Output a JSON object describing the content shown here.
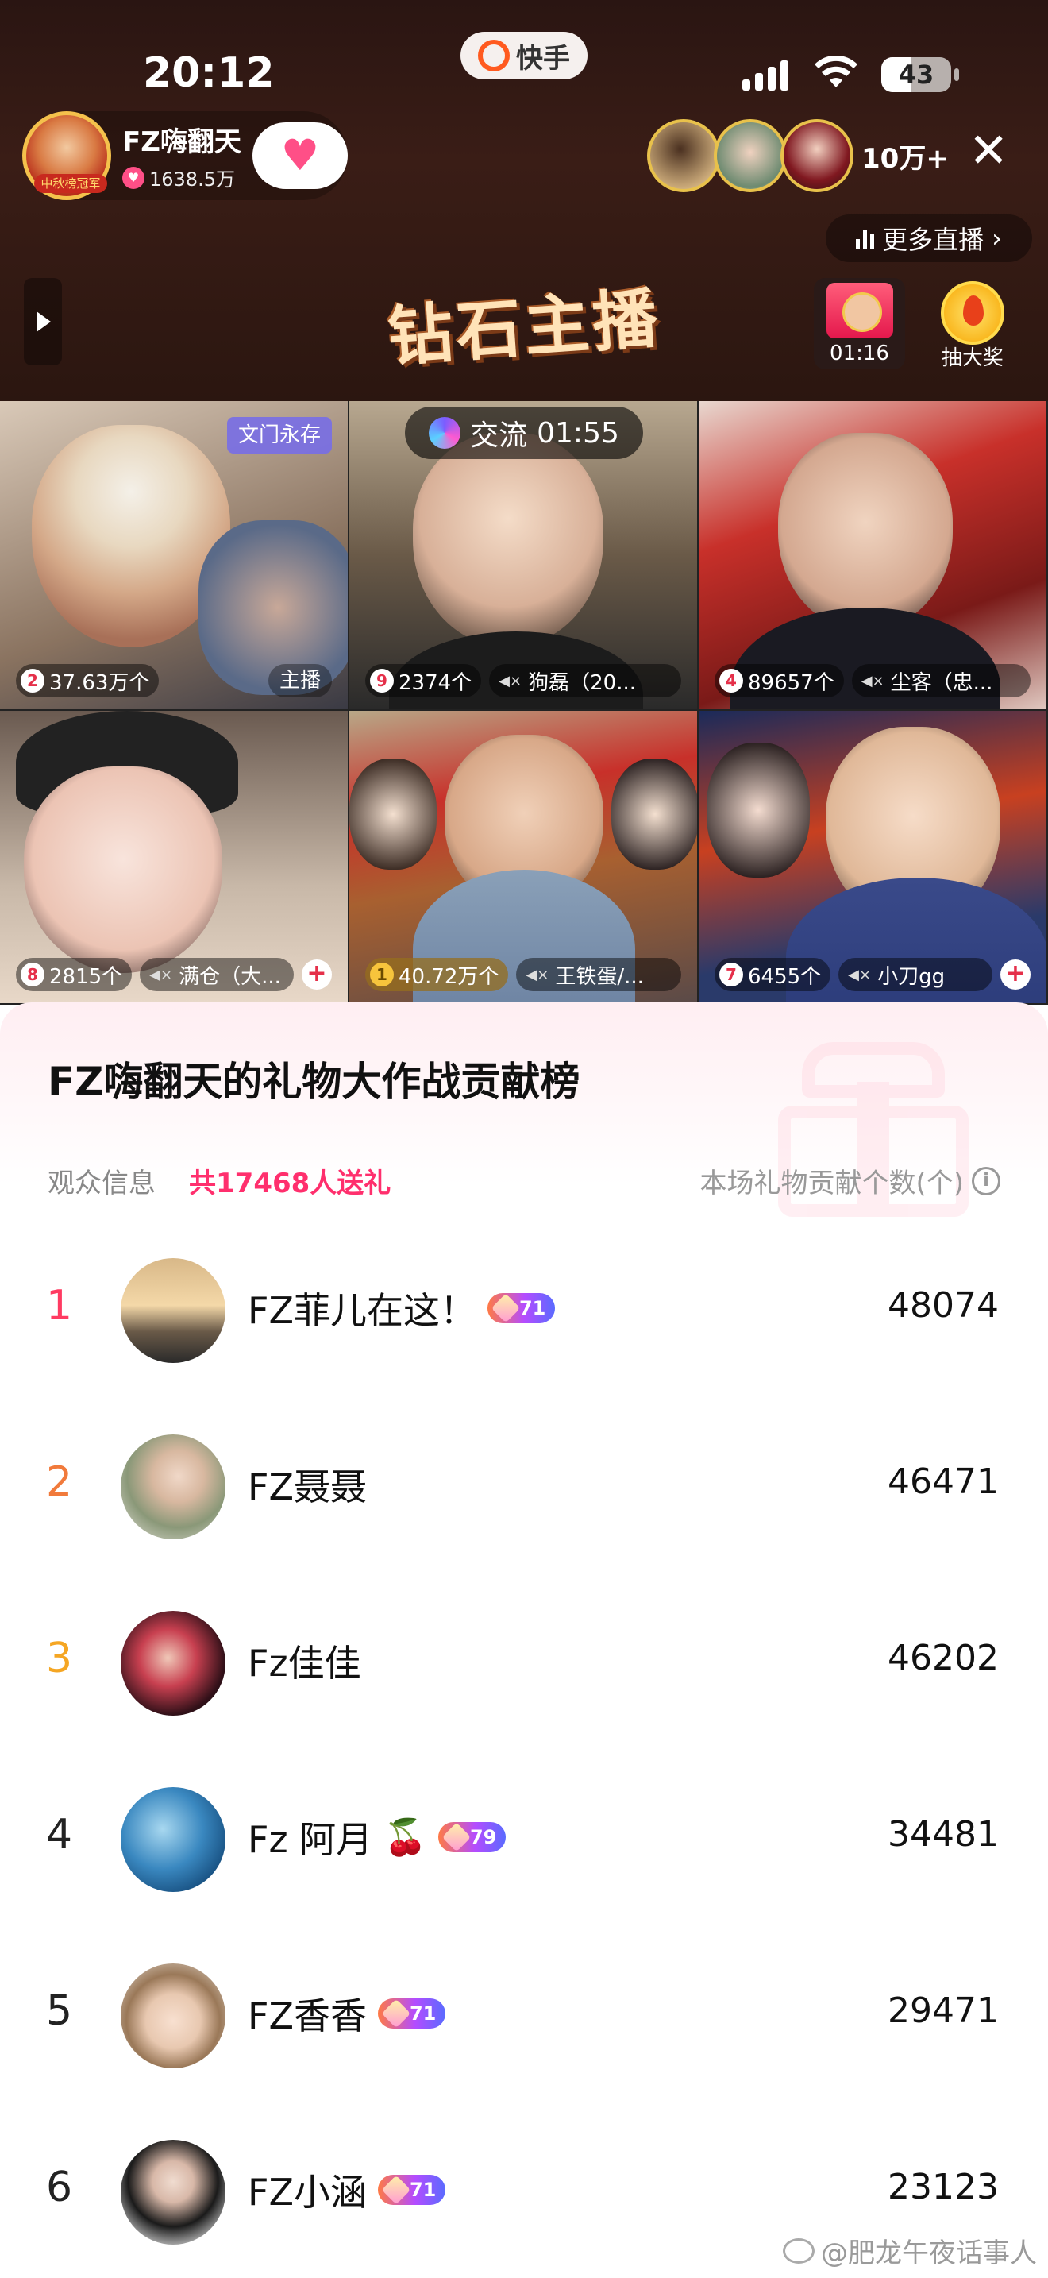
{
  "status_bar": {
    "time": "20:12",
    "battery": "43"
  },
  "app": {
    "name": "快手"
  },
  "host": {
    "name": "FZ嗨翻天",
    "likes": "1638.5万",
    "avatar_badge": "中秋榜冠军"
  },
  "viewers": {
    "count": "10万+"
  },
  "more_live_label": "更多直播",
  "banner_text": "钻石主播",
  "gift_timer": "01:16",
  "lottery_label": "抽大奖",
  "pk_timer": {
    "label": "交流",
    "time": "01:55"
  },
  "grid": [
    {
      "rank": "2",
      "count": "37.63万个",
      "tag": "文门永存",
      "right": "主播"
    },
    {
      "rank": "9",
      "count": "2374个",
      "name": "狗磊（20..."
    },
    {
      "rank": "4",
      "count": "89657个",
      "name": "尘客（忠..."
    },
    {
      "rank": "8",
      "count": "2815个",
      "name": "满仓（大..."
    },
    {
      "rank": "1",
      "count": "40.72万个",
      "name": "王铁蛋/..."
    },
    {
      "rank": "7",
      "count": "6455个",
      "name": "小刀gg"
    }
  ],
  "sheet": {
    "title": "FZ嗨翻天的礼物大作战贡献榜",
    "info_label": "观众信息",
    "info_count": "共17468人送礼",
    "info_right": "本场礼物贡献个数(个)",
    "info_icon": "i"
  },
  "leaderboard": [
    {
      "rank": "1",
      "name": "FZ菲儿在这！",
      "level": "71",
      "value": "48074"
    },
    {
      "rank": "2",
      "name": "FZ聂聂",
      "level": "",
      "value": "46471"
    },
    {
      "rank": "3",
      "name": "Fz佳佳",
      "level": "",
      "value": "46202"
    },
    {
      "rank": "4",
      "name": "Fz 阿月",
      "level": "79",
      "value": "34481"
    },
    {
      "rank": "5",
      "name": "FZ香香",
      "level": "71",
      "value": "29471"
    },
    {
      "rank": "6",
      "name": "FZ小涵",
      "level": "71",
      "value": "23123"
    }
  ],
  "watermark": "@肥龙午夜话事人",
  "colors": {
    "accent_pink": "#ff2f6d",
    "rank1": "#ff3b62",
    "rank2": "#f17a3b",
    "rank3": "#f5a623"
  }
}
